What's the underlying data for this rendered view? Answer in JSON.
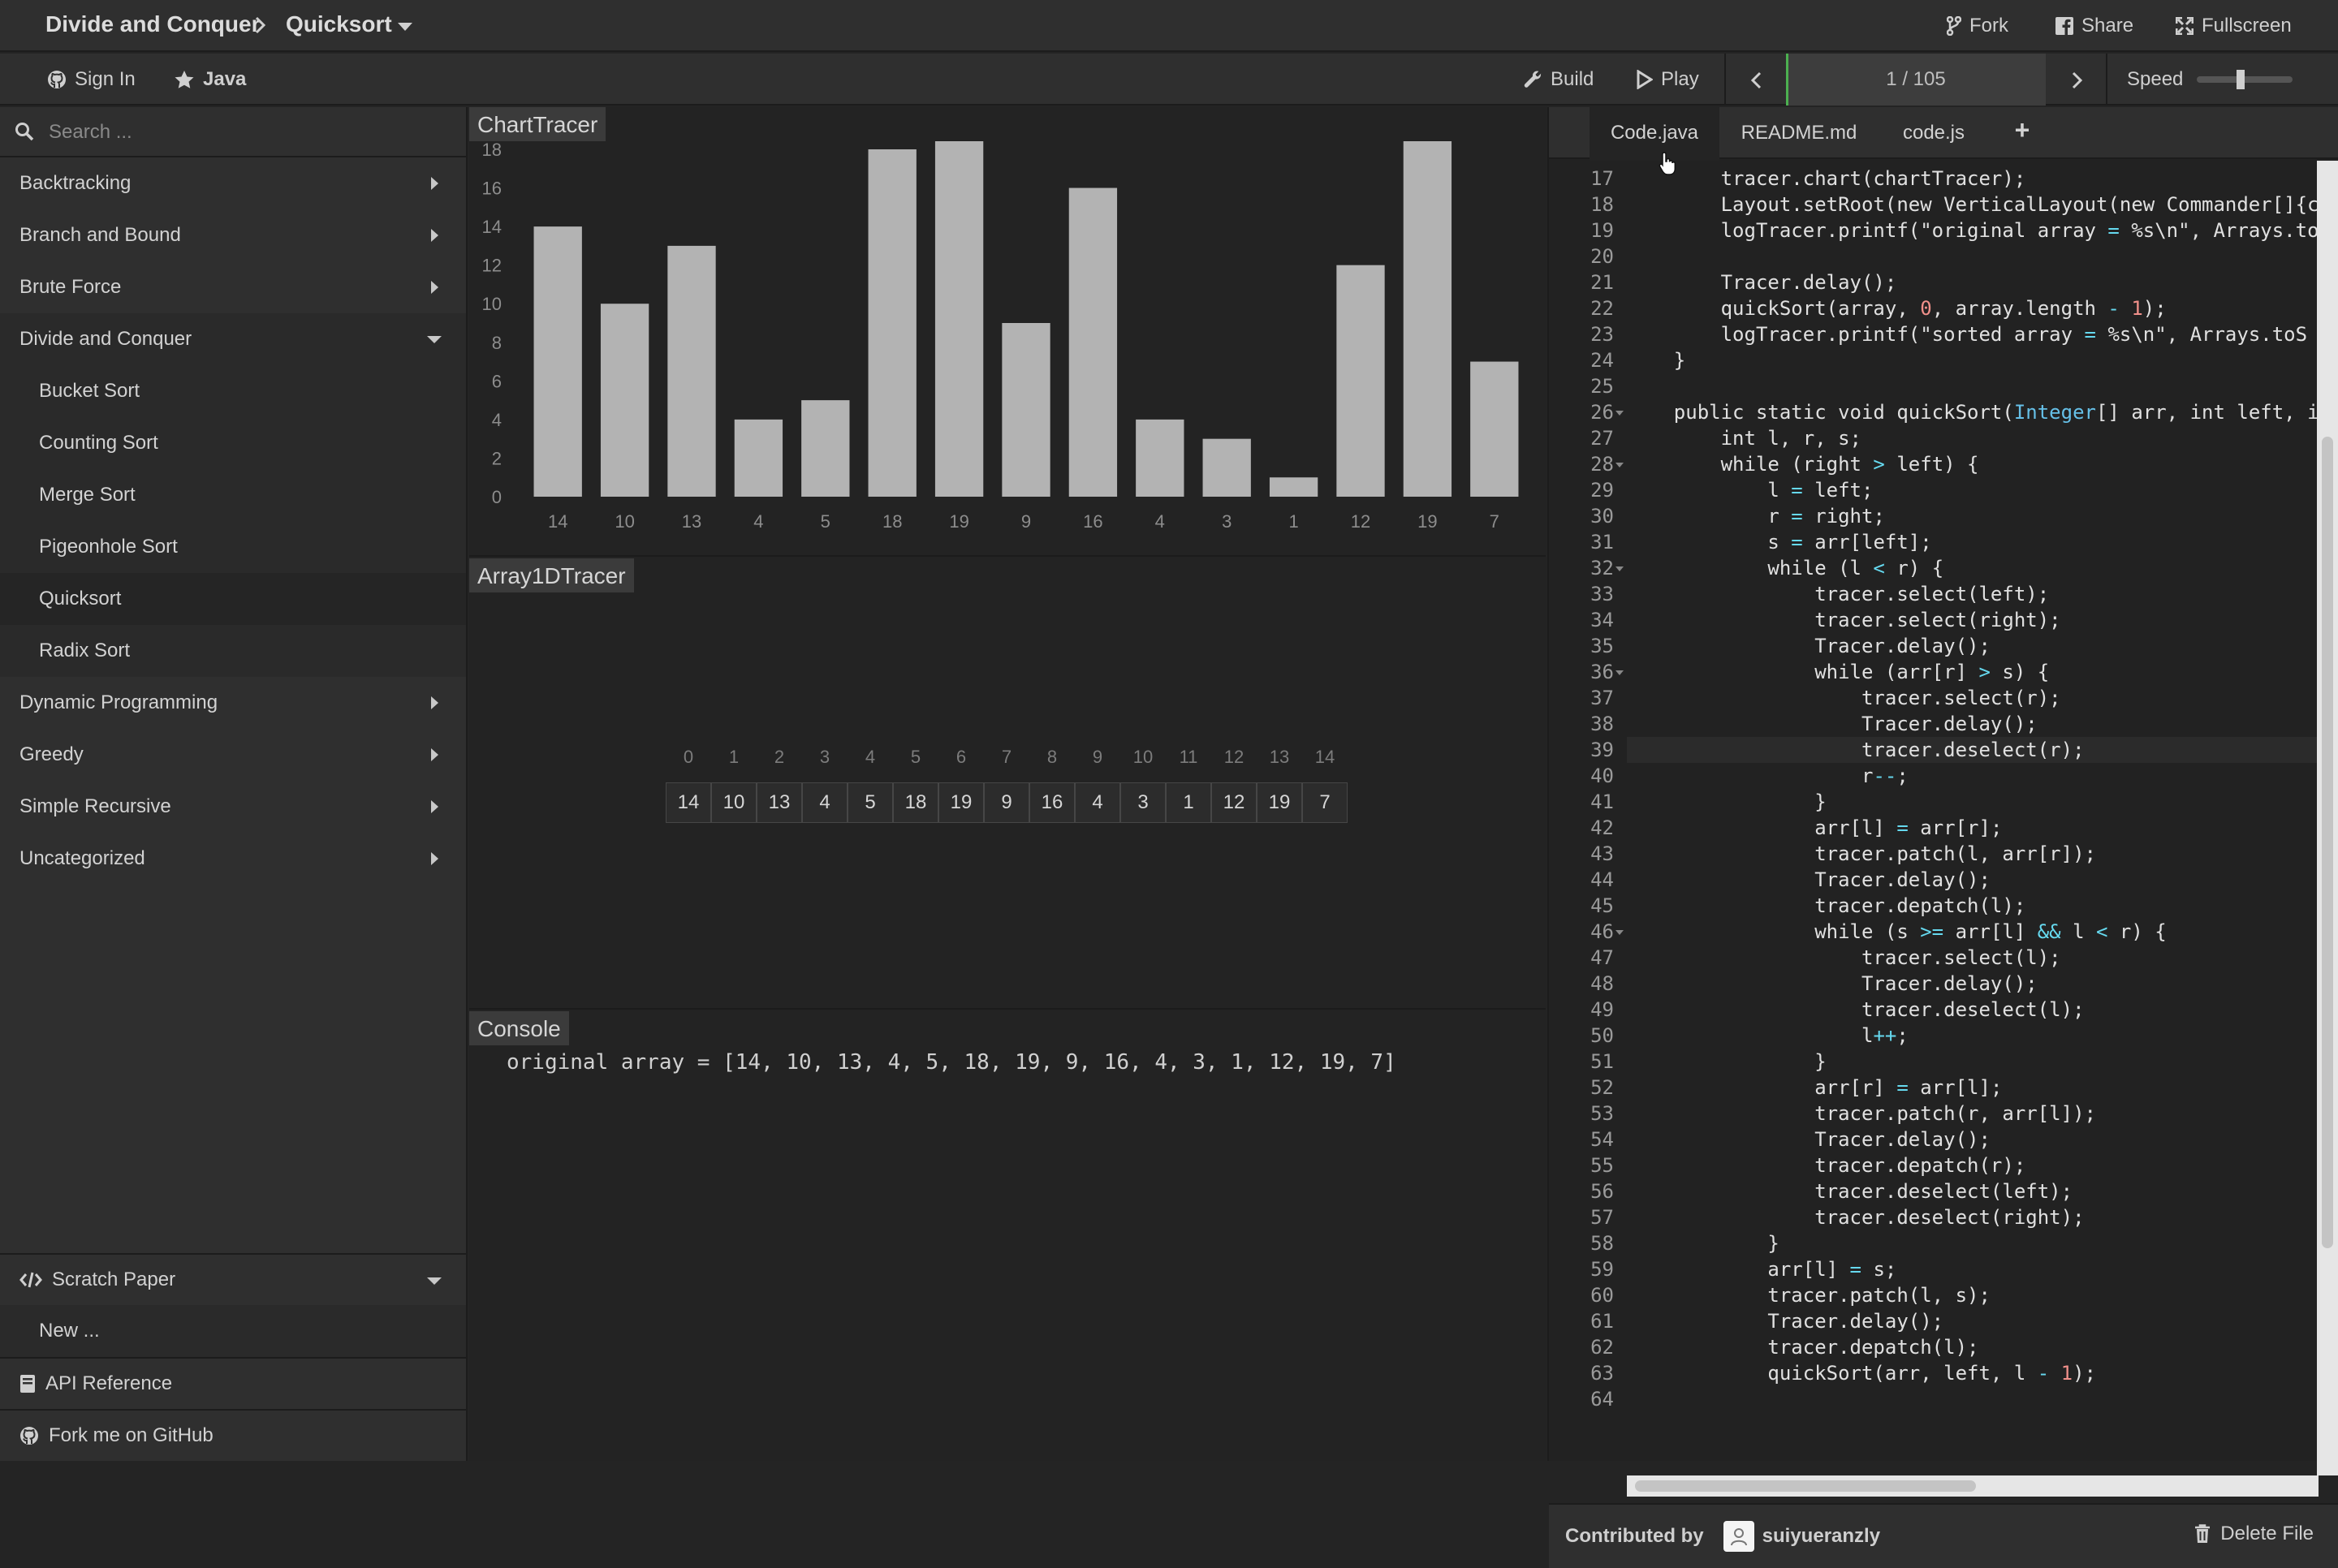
{
  "header": {
    "category": "Divide and Conquer",
    "algorithm": "Quicksort",
    "fork_label": "Fork",
    "share_label": "Share",
    "fullscreen_label": "Fullscreen"
  },
  "toolbar": {
    "signin_label": "Sign In",
    "language_label": "Java",
    "build_label": "Build",
    "play_label": "Play",
    "step_counter": "1 / 105",
    "speed_label": "Speed",
    "speed_level": 0.45
  },
  "sidebar": {
    "search_placeholder": "Search ...",
    "categories": [
      {
        "label": "Backtracking",
        "open": false
      },
      {
        "label": "Branch and Bound",
        "open": false
      },
      {
        "label": "Brute Force",
        "open": false
      },
      {
        "label": "Divide and Conquer",
        "open": true,
        "items": [
          "Bucket Sort",
          "Counting Sort",
          "Merge Sort",
          "Pigeonhole Sort",
          "Quicksort",
          "Radix Sort"
        ],
        "active": "Quicksort"
      },
      {
        "label": "Dynamic Programming",
        "open": false
      },
      {
        "label": "Greedy",
        "open": false
      },
      {
        "label": "Simple Recursive",
        "open": false
      },
      {
        "label": "Uncategorized",
        "open": false
      }
    ],
    "scratch_paper_label": "Scratch Paper",
    "new_label": "New ...",
    "api_reference_label": "API Reference",
    "github_label": "Fork me on GitHub"
  },
  "panels": {
    "chart_title": "ChartTracer",
    "array_title": "Array1DTracer",
    "console_title": "Console",
    "console_line": "original array = [14, 10, 13, 4, 5, 18, 19, 9, 16, 4, 3, 1, 12, 19, 7]"
  },
  "chart_data": {
    "type": "bar",
    "categories": [
      "14",
      "10",
      "13",
      "4",
      "5",
      "18",
      "19",
      "9",
      "16",
      "4",
      "3",
      "1",
      "12",
      "19",
      "7"
    ],
    "values": [
      14,
      10,
      13,
      4,
      5,
      18,
      19,
      9,
      16,
      4,
      3,
      1,
      12,
      19,
      7
    ],
    "yticks": [
      0,
      2,
      4,
      6,
      8,
      10,
      12,
      14,
      16,
      18
    ],
    "ylim": [
      0,
      18
    ],
    "bar_color": "#b3b3b3"
  },
  "array": {
    "indices": [
      "0",
      "1",
      "2",
      "3",
      "4",
      "5",
      "6",
      "7",
      "8",
      "9",
      "10",
      "11",
      "12",
      "13",
      "14"
    ],
    "values": [
      "14",
      "10",
      "13",
      "4",
      "5",
      "18",
      "19",
      "9",
      "16",
      "4",
      "3",
      "1",
      "12",
      "19",
      "7"
    ]
  },
  "editor": {
    "tabs": [
      "Code.java",
      "README.md",
      "code.js"
    ],
    "active_tab": "Code.java",
    "add_tab_label": "+",
    "active_line": 39,
    "lines": [
      {
        "n": "17",
        "t": "        tracer.chart(chartTracer);"
      },
      {
        "n": "18",
        "t": "        Layout.setRoot(new VerticalLayout(new Commander[]{c"
      },
      {
        "n": "19",
        "t": "        logTracer.printf(\"original array = %s\\n\", Arrays.to"
      },
      {
        "n": "20",
        "t": ""
      },
      {
        "n": "21",
        "t": "        Tracer.delay();"
      },
      {
        "n": "22",
        "t": "        quickSort(array, 0, array.length - 1);"
      },
      {
        "n": "23",
        "t": "        logTracer.printf(\"sorted array = %s\\n\", Arrays.toS"
      },
      {
        "n": "24",
        "t": "    }"
      },
      {
        "n": "25",
        "t": ""
      },
      {
        "n": "26",
        "t": "    public static void quickSort(Integer[] arr, int left, i"
      },
      {
        "n": "27",
        "t": "        int l, r, s;"
      },
      {
        "n": "28",
        "t": "        while (right > left) {"
      },
      {
        "n": "29",
        "t": "            l = left;"
      },
      {
        "n": "30",
        "t": "            r = right;"
      },
      {
        "n": "31",
        "t": "            s = arr[left];"
      },
      {
        "n": "32",
        "t": "            while (l < r) {"
      },
      {
        "n": "33",
        "t": "                tracer.select(left);"
      },
      {
        "n": "34",
        "t": "                tracer.select(right);"
      },
      {
        "n": "35",
        "t": "                Tracer.delay();"
      },
      {
        "n": "36",
        "t": "                while (arr[r] > s) {"
      },
      {
        "n": "37",
        "t": "                    tracer.select(r);"
      },
      {
        "n": "38",
        "t": "                    Tracer.delay();"
      },
      {
        "n": "39",
        "t": "                    tracer.deselect(r);"
      },
      {
        "n": "40",
        "t": "                    r--;"
      },
      {
        "n": "41",
        "t": "                }"
      },
      {
        "n": "42",
        "t": "                arr[l] = arr[r];"
      },
      {
        "n": "43",
        "t": "                tracer.patch(l, arr[r]);"
      },
      {
        "n": "44",
        "t": "                Tracer.delay();"
      },
      {
        "n": "45",
        "t": "                tracer.depatch(l);"
      },
      {
        "n": "46",
        "t": "                while (s >= arr[l] && l < r) {"
      },
      {
        "n": "47",
        "t": "                    tracer.select(l);"
      },
      {
        "n": "48",
        "t": "                    Tracer.delay();"
      },
      {
        "n": "49",
        "t": "                    tracer.deselect(l);"
      },
      {
        "n": "50",
        "t": "                    l++;"
      },
      {
        "n": "51",
        "t": "                }"
      },
      {
        "n": "52",
        "t": "                arr[r] = arr[l];"
      },
      {
        "n": "53",
        "t": "                tracer.patch(r, arr[l]);"
      },
      {
        "n": "54",
        "t": "                Tracer.delay();"
      },
      {
        "n": "55",
        "t": "                tracer.depatch(r);"
      },
      {
        "n": "56",
        "t": "                tracer.deselect(left);"
      },
      {
        "n": "57",
        "t": "                tracer.deselect(right);"
      },
      {
        "n": "58",
        "t": "            }"
      },
      {
        "n": "59",
        "t": "            arr[l] = s;"
      },
      {
        "n": "60",
        "t": "            tracer.patch(l, s);"
      },
      {
        "n": "61",
        "t": "            Tracer.delay();"
      },
      {
        "n": "62",
        "t": "            tracer.depatch(l);"
      },
      {
        "n": "63",
        "t": "            quickSort(arr, left, l - 1);"
      },
      {
        "n": "64",
        "t": ""
      }
    ],
    "fold_lines": [
      "26",
      "28",
      "32",
      "36",
      "46"
    ],
    "contributed_by_label": "Contributed by",
    "contributor": "suiyueranzly",
    "delete_file_label": "Delete File"
  }
}
